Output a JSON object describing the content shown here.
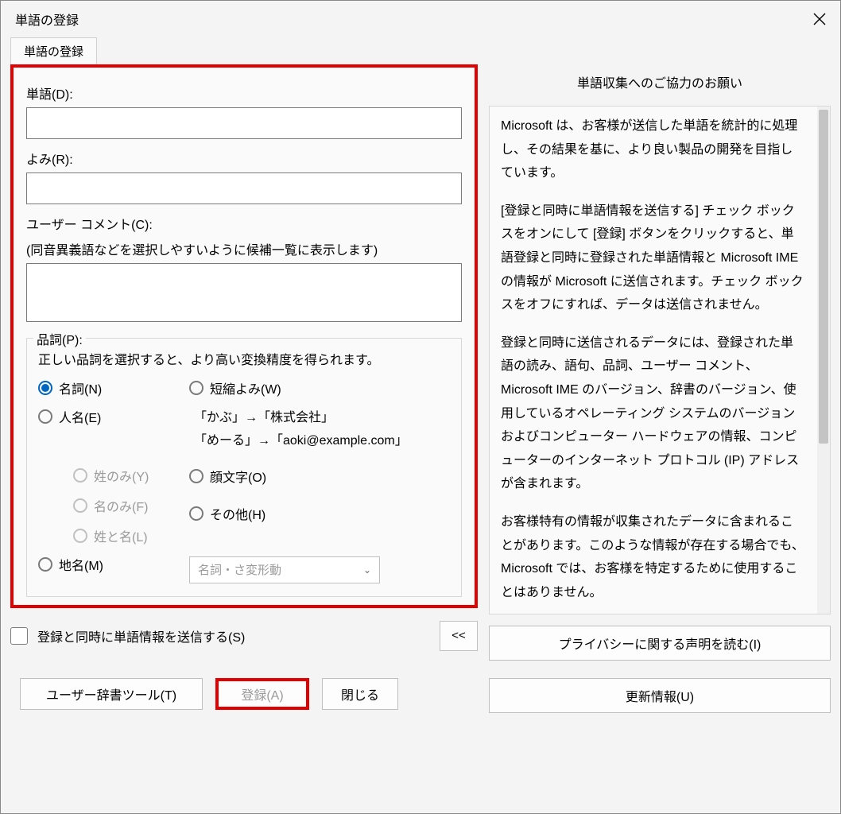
{
  "window": {
    "title": "単語の登録"
  },
  "tab": {
    "label": "単語の登録"
  },
  "fields": {
    "word_label": "単語(D):",
    "word_value": "",
    "reading_label": "よみ(R):",
    "reading_value": "",
    "comment_label": "ユーザー コメント(C):",
    "comment_hint": "(同音異義語などを選択しやすいように候補一覧に表示します)",
    "comment_value": ""
  },
  "pos": {
    "legend": "品詞(P):",
    "desc": "正しい品詞を選択すると、より高い変換精度を得られます。",
    "noun": "名詞(N)",
    "person": "人名(E)",
    "surname_only": "姓のみ(Y)",
    "given_only": "名のみ(F)",
    "full_name": "姓と名(L)",
    "place": "地名(M)",
    "abbrev": "短縮よみ(W)",
    "example1": "「かぶ」→「株式会社」",
    "example2": "「めーる」→「aoki@example.com」",
    "emoji": "顔文字(O)",
    "other": "その他(H)",
    "dropdown": "名詞・さ変形動"
  },
  "send_checkbox": "登録と同時に単語情報を送信する(S)",
  "collapse": "<<",
  "buttons": {
    "tool": "ユーザー辞書ツール(T)",
    "register": "登録(A)",
    "close": "閉じる"
  },
  "info": {
    "title": "単語収集へのご協力のお願い",
    "p1": "Microsoft は、お客様が送信した単語を統計的に処理し、その結果を基に、より良い製品の開発を目指しています。",
    "p2": "[登録と同時に単語情報を送信する] チェック ボックスをオンにして [登録] ボタンをクリックすると、単語登録と同時に登録された単語情報と Microsoft IME の情報が Microsoft に送信されます。チェック ボックスをオフにすれば、データは送信されません。",
    "p3": "登録と同時に送信されるデータには、登録された単語の読み、語句、品詞、ユーザー コメント、Microsoft IME のバージョン、辞書のバージョン、使用しているオペレーティング システムのバージョンおよびコンピューター ハードウェアの情報、コンピューターのインターネット プロトコル (IP) アドレスが含まれます。",
    "p4": "お客様特有の情報が収集されたデータに含まれることがあります。このような情報が存在する場合でも、Microsoft では、お客様を特定するために使用することはありません。",
    "privacy_btn": "プライバシーに関する声明を読む(I)",
    "update_btn": "更新情報(U)"
  }
}
